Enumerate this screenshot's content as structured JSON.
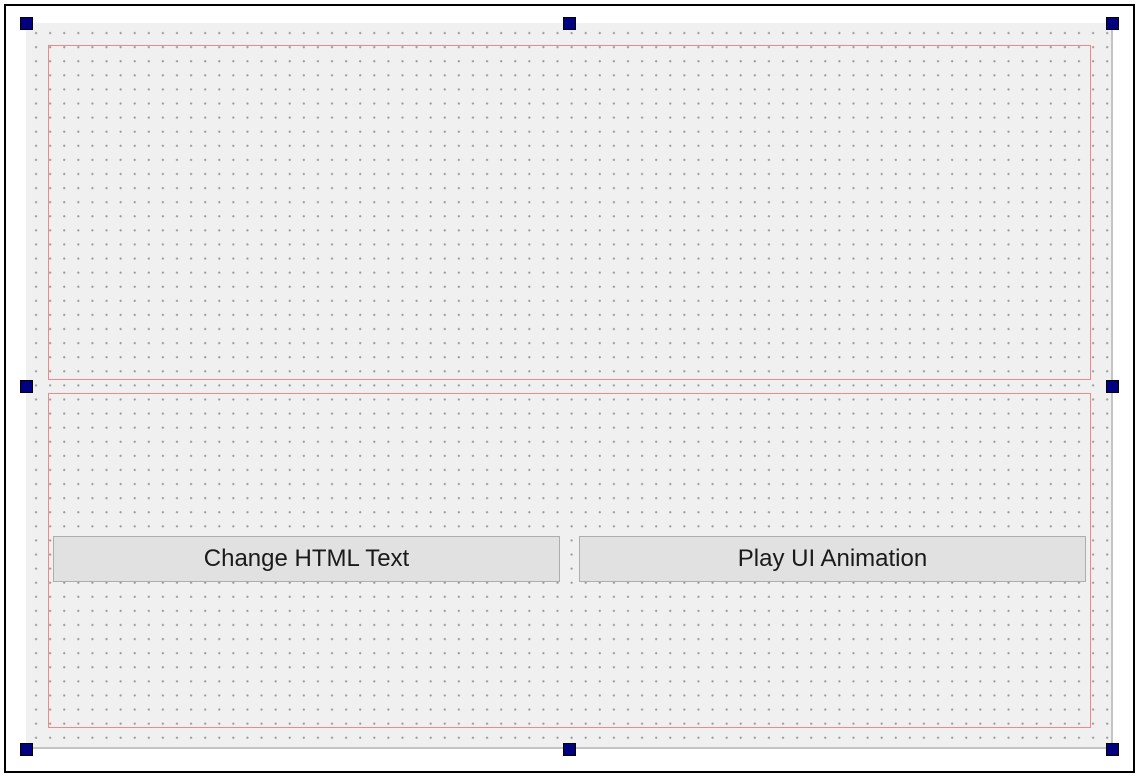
{
  "form": {
    "buttons": {
      "change_html_text": "Change HTML Text",
      "play_ui_animation": "Play UI Animation"
    }
  },
  "colors": {
    "surface": "#f0f0f0",
    "layout_border": "#f08a8a",
    "button_bg": "#e1e1e1",
    "selection_handle": "#000080"
  }
}
